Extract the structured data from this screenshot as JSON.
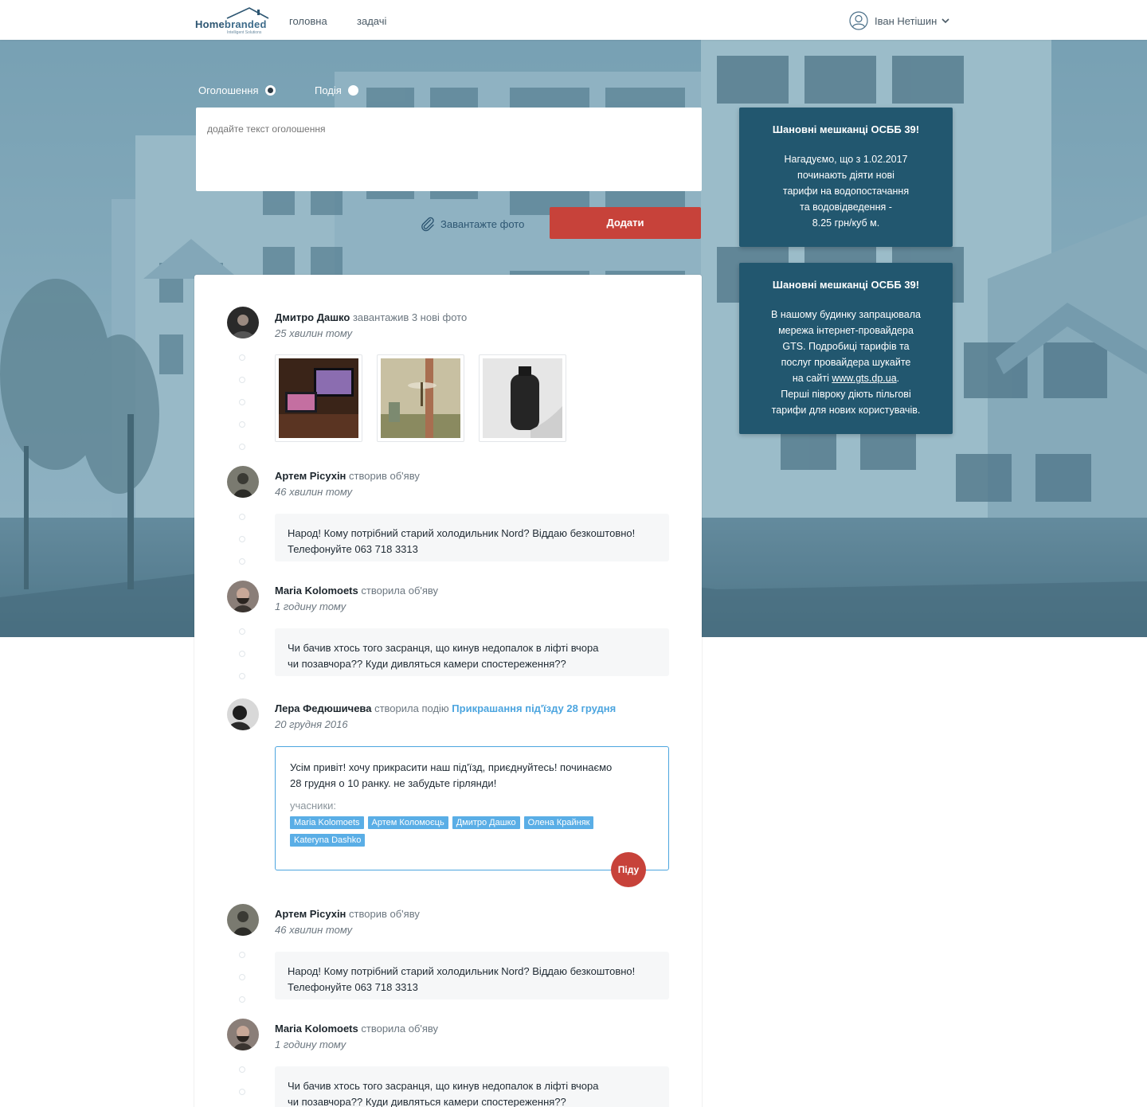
{
  "header": {
    "logo_text_a": "Home",
    "logo_text_b": "branded",
    "logo_sub": "Intelligent Solutions",
    "nav": [
      "головна",
      "задачі"
    ],
    "user_name": "Іван Нетішин"
  },
  "composer": {
    "options": [
      "Оголошення",
      "Подія"
    ],
    "selected": "Оголошення",
    "placeholder": "додайте текст оголошення",
    "upload_label": "Завантажте фото",
    "submit_label": "Додати"
  },
  "notices": [
    {
      "title": "Шановні мешканці ОСББ 39!",
      "lines": [
        "Нагадуємо, що з 1.02.2017",
        "починають діяти нові",
        "тарифи на водопостачання",
        "та водовідведення -",
        "8.25 грн/куб м."
      ]
    },
    {
      "title": "Шановні мешканці ОСББ 39!",
      "lines": [
        "В нашому будинку запрацювала",
        "мережа інтернет-провайдера",
        "GTS. Подробиці тарифів та",
        "послуг провайдера шукайте"
      ],
      "link_prefix": "на сайті ",
      "link": "www.gts.dp.ua",
      "link_suffix": ".",
      "lines_after": [
        "Перші півроку діють пільгові",
        "тарифи для нових користувачів."
      ]
    }
  ],
  "feed": [
    {
      "author": "Дмитро Дашко",
      "action": "завантажив 3 нові фото",
      "time": "25 хвилин тому",
      "photo_names": [
        "laptop-desk-photo",
        "dragonfly-photo",
        "hugo-bottle-photo"
      ]
    },
    {
      "author": "Артем Рісухін",
      "action": "створив об'яву",
      "time": "46 хвилин тому",
      "lines": [
        "Народ! Кому потрібний старий холодильник Nord? Віддаю безкоштовно!",
        "Телефонуйте 063 718 3313"
      ]
    },
    {
      "author": "Maria Kolomoets",
      "action": "створила об'яву",
      "time": "1 годину тому",
      "lines": [
        "Чи бачив хтось того засранця, що кинув недопалок в ліфті вчора",
        "чи позавчора?? Куди дивляться камери спостереження??"
      ]
    },
    {
      "author": "Лера Федюшичева",
      "action": "створила подію",
      "event_name": "Прикрашання під'їзду 28 грудня",
      "time": "20 грудня 2016",
      "lines": [
        "Усім привіт! хочу прикрасити наш під'їзд, приєднуйтесь! починаємо",
        "28 грудня о 10 ранку. не забудьте гірлянди!"
      ],
      "participants_label": "учасники:",
      "participants": [
        "Maria Kolomoets",
        "Артем Коломоєць",
        "Дмитро Дашко",
        "Олена Крайняк",
        "Kateryna Dashko"
      ],
      "join_label": "Піду"
    },
    {
      "author": "Артем Рісухін",
      "action": "створив об'яву",
      "time": "46 хвилин тому",
      "lines": [
        "Народ! Кому потрібний старий холодильник Nord? Віддаю безкоштовно!",
        "Телефонуйте 063 718 3313"
      ]
    },
    {
      "author": "Maria Kolomoets",
      "action": "створила об'яву",
      "time": "1 годину тому",
      "lines": [
        "Чи бачив хтось того засранця, що кинув недопалок в ліфті вчора",
        "чи позавчора?? Куди дивляться камери спостереження??"
      ]
    }
  ],
  "colors": {
    "accent_red": "#c7423a",
    "notice_bg": "#22576f",
    "link_blue": "#4ca5df",
    "hero_tint": "#6e98ab"
  }
}
